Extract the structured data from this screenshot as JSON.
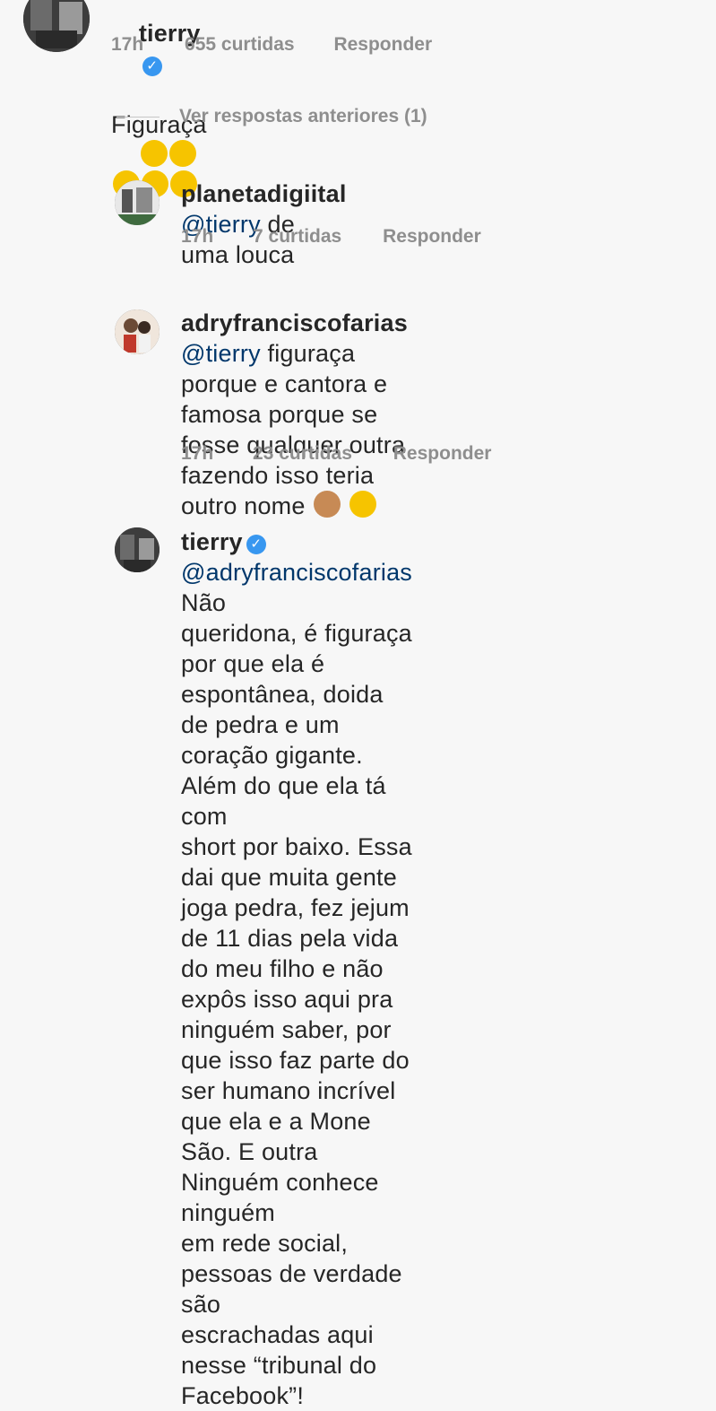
{
  "top_comment": {
    "username": "tierry",
    "text": "Figuraça",
    "emojis": [
      "rolling-on-floor-laughing",
      "rolling-on-floor-laughing",
      "rolling-on-floor-laughing",
      "rolling-on-floor-laughing",
      "rolling-on-floor-laughing"
    ],
    "time": "17h",
    "likes": "655 curtidas",
    "reply": "Responder"
  },
  "view_previous": "Ver respostas anteriores (1)",
  "replies": [
    {
      "username": "planetadigiital",
      "mention": "@tierry",
      "text": " de uma louca",
      "time": "17h",
      "likes": "7 curtidas",
      "reply": "Responder"
    },
    {
      "username": "adryfranciscofarias",
      "mention": "@tierry",
      "text": " figuraça\nporque e cantora e famosa porque se\nfosse qualquer outra fazendo isso teria\noutro nome",
      "emojis": [
        "see-no-evil-monkey",
        "thinking-face"
      ],
      "time": "17h",
      "likes": "23 curtidas",
      "reply": "Responder"
    },
    {
      "username": "tierry",
      "verified": true,
      "mention": "@adryfranciscofarias",
      "text": " Não\nqueridona, é figuraça por que ela é\nespontânea, doida de pedra e um\ncoração gigante. Além do que ela tá com\nshort por baixo. Essa dai que muita gente\njoga pedra, fez jejum de 11 dias pela vida\ndo meu filho e não expôs isso aqui pra\nninguém saber, por que isso faz parte do\nser humano incrível que ela e a Mone\nSão. E outra Ninguém conhece ninguém\nem rede social, pessoas de verdade são\nescrachadas aqui nesse “tribunal do\nFacebook”!"
    }
  ],
  "colors": {
    "background": "#f7f7f7",
    "text": "#262626",
    "mention": "#00376b",
    "meta": "#8e8e8e",
    "verified": "#3897f0"
  }
}
